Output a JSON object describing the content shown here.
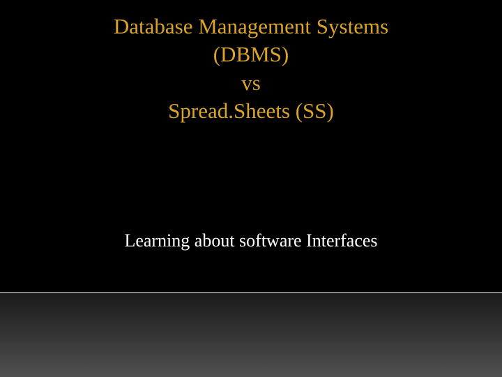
{
  "slide": {
    "title_line1": "Database Management Systems",
    "title_line2": "(DBMS)",
    "title_line3": "vs",
    "title_line4": "Spread.Sheets (SS)",
    "subtitle": "Learning about software Interfaces"
  }
}
